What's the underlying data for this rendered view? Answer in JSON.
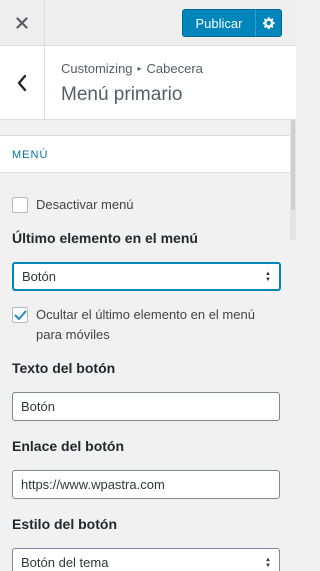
{
  "topbar": {
    "close_icon": "close-icon",
    "publish_label": "Publicar",
    "gear_icon": "gear-icon",
    "accent": "#0085ba"
  },
  "header": {
    "back_icon": "chevron-left-icon",
    "breadcrumb_root": "Customizing",
    "breadcrumb_separator": "▸",
    "breadcrumb_current": "Cabecera",
    "title": "Menú primario"
  },
  "section": {
    "title": "MENÚ"
  },
  "controls": {
    "disable_menu": {
      "label": "Desactivar menú",
      "checked": false
    },
    "last_item": {
      "label": "Último elemento en el menú",
      "selected": "Botón"
    },
    "hide_mobile": {
      "label_line1": "Ocultar el último elemento en el menú",
      "label_line2": "para móviles",
      "checked": true
    },
    "button_text": {
      "label": "Texto del botón",
      "value": "Botón"
    },
    "button_link": {
      "label": "Enlace del botón",
      "value": "https://www.wpastra.com"
    },
    "button_style": {
      "label": "Estilo del botón",
      "selected": "Botón del tema"
    }
  }
}
